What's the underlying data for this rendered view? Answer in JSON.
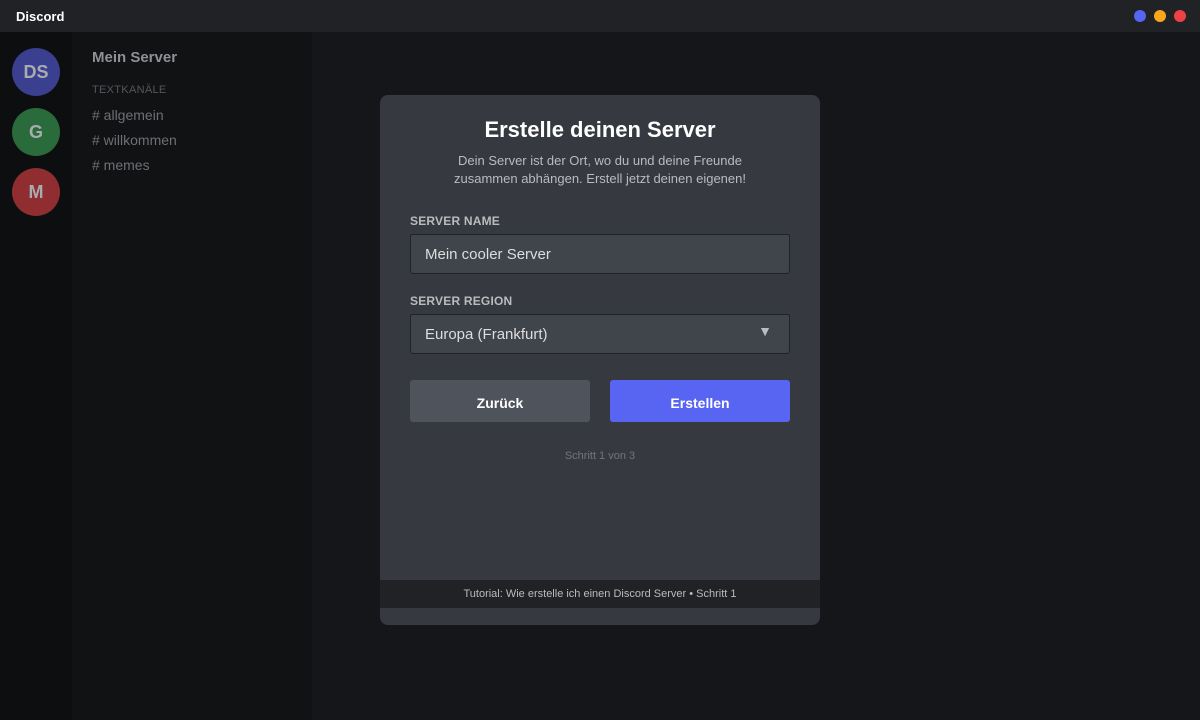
{
  "window": {
    "title": "Discord",
    "dots": [
      "#5865f2",
      "#faa61a",
      "#ed4245"
    ]
  },
  "servers": [
    {
      "label": "DS",
      "color": "#3a3f8f"
    },
    {
      "label": "G",
      "color": "#2a6b3c"
    },
    {
      "label": "M",
      "color": "#8f2d30"
    }
  ],
  "sidebar": {
    "server_name": "Mein Server",
    "category": "TEXTKANÄLE",
    "channels": [
      "# allgemein",
      "# willkommen",
      "# memes"
    ]
  },
  "modal": {
    "title": "Erstelle deinen Server",
    "subtitle": "Dein Server ist der Ort, wo du und deine Freunde zusammen abhängen. Erstell jetzt deinen eigenen!",
    "server_name_label": "SERVER NAME",
    "server_name_value": "Mein cooler Server",
    "region_label": "SERVER REGION",
    "region_value": "Europa (Frankfurt)",
    "dropdown_icon": "▼",
    "back_label": "Zurück",
    "create_label": "Erstellen",
    "step": "Schritt 1 von 3",
    "tutorial": "Tutorial: Wie erstelle ich einen Discord Server • Schritt 1"
  },
  "colors": {
    "accent": "#5865f2",
    "secondary_button": "#4f545c"
  }
}
